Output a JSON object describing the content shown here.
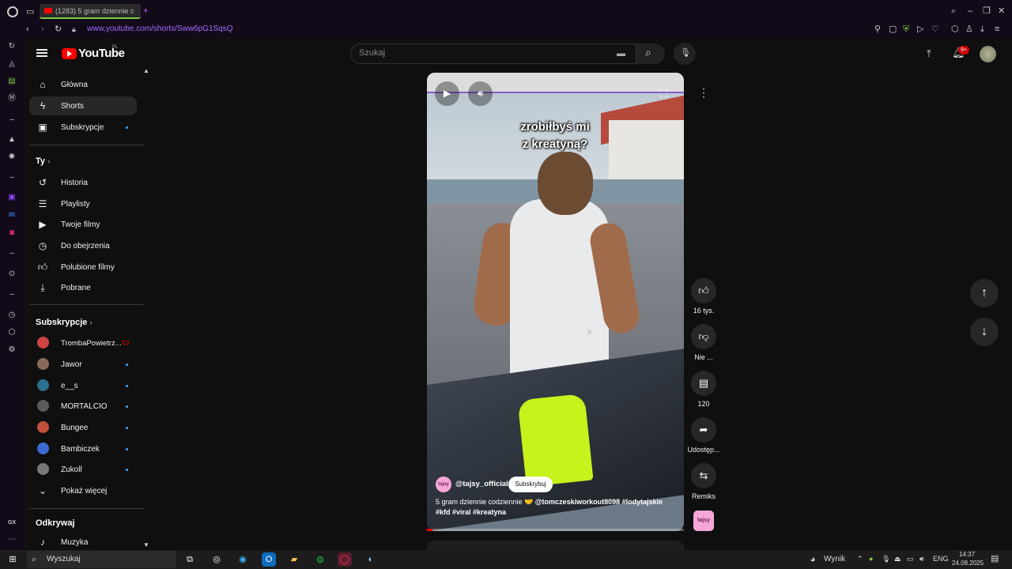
{
  "browser": {
    "tab_title": "(1283) 5 gram dziennie c",
    "url": "www.youtube.com/shorts/Sww6pG1SqsQ"
  },
  "header": {
    "logo_text": "YouTube",
    "logo_region": "PL",
    "search_placeholder": "Szukaj",
    "notifications_badge": "9+"
  },
  "sidebar": {
    "main": [
      {
        "label": "Główna",
        "icon": "home-icon"
      },
      {
        "label": "Shorts",
        "icon": "shorts-icon"
      },
      {
        "label": "Subskrypcje",
        "icon": "subscriptions-icon"
      }
    ],
    "you_title": "Ty",
    "you_items": [
      {
        "label": "Historia",
        "icon": "history-icon"
      },
      {
        "label": "Playlisty",
        "icon": "playlist-icon"
      },
      {
        "label": "Twoje filmy",
        "icon": "your-videos-icon"
      },
      {
        "label": "Do obejrzenia",
        "icon": "watch-later-icon"
      },
      {
        "label": "Polubione filmy",
        "icon": "liked-icon"
      },
      {
        "label": "Pobrane",
        "icon": "download-icon"
      }
    ],
    "subs_title": "Subskrypcje",
    "subs": [
      {
        "label": "TrombaPowietrz...",
        "live": true,
        "color": "#c44"
      },
      {
        "label": "Jawor",
        "live": false,
        "color": "#8a6a5a"
      },
      {
        "label": "e__s",
        "live": false,
        "color": "#2a6f8f"
      },
      {
        "label": "MORTALCIO",
        "live": false,
        "color": "#5a5a5a"
      },
      {
        "label": "Bungee",
        "live": false,
        "color": "#c0503a"
      },
      {
        "label": "Bambiczek",
        "live": false,
        "color": "#3a6ad0"
      },
      {
        "label": "Zukoll",
        "live": false,
        "color": "#777"
      }
    ],
    "show_more": "Pokaż więcej",
    "explore_title": "Odkrywaj",
    "explore_items": [
      {
        "label": "Muzyka",
        "icon": "music-icon"
      }
    ]
  },
  "video": {
    "overlay_caption_line1": "zrobiłbyś mi",
    "overlay_caption_line2": "z kreatyną?",
    "channel_avatar_text": "tajsy",
    "channel_handle": "@tajsy_official",
    "subscribe_label": "Subskrybuj",
    "description_plain": "5 gram dziennie codziennie 🤝 ",
    "description_tags": "@tomczeskiworkout8098 #lodytajskie #kfd #viral #kreatyna",
    "progress": 0.02
  },
  "actions": {
    "likes": "16 tys.",
    "dislike_label": "Nie ...",
    "comments": "120",
    "share_label": "Udostęp...",
    "remix_label": "Remiks",
    "sound_avatar_text": "tajsy"
  },
  "taskbar": {
    "search_label": "Wyszukaj",
    "weather_label": "Wynik",
    "language": "ENG",
    "time": "14:37",
    "date": "24.08.2025"
  }
}
